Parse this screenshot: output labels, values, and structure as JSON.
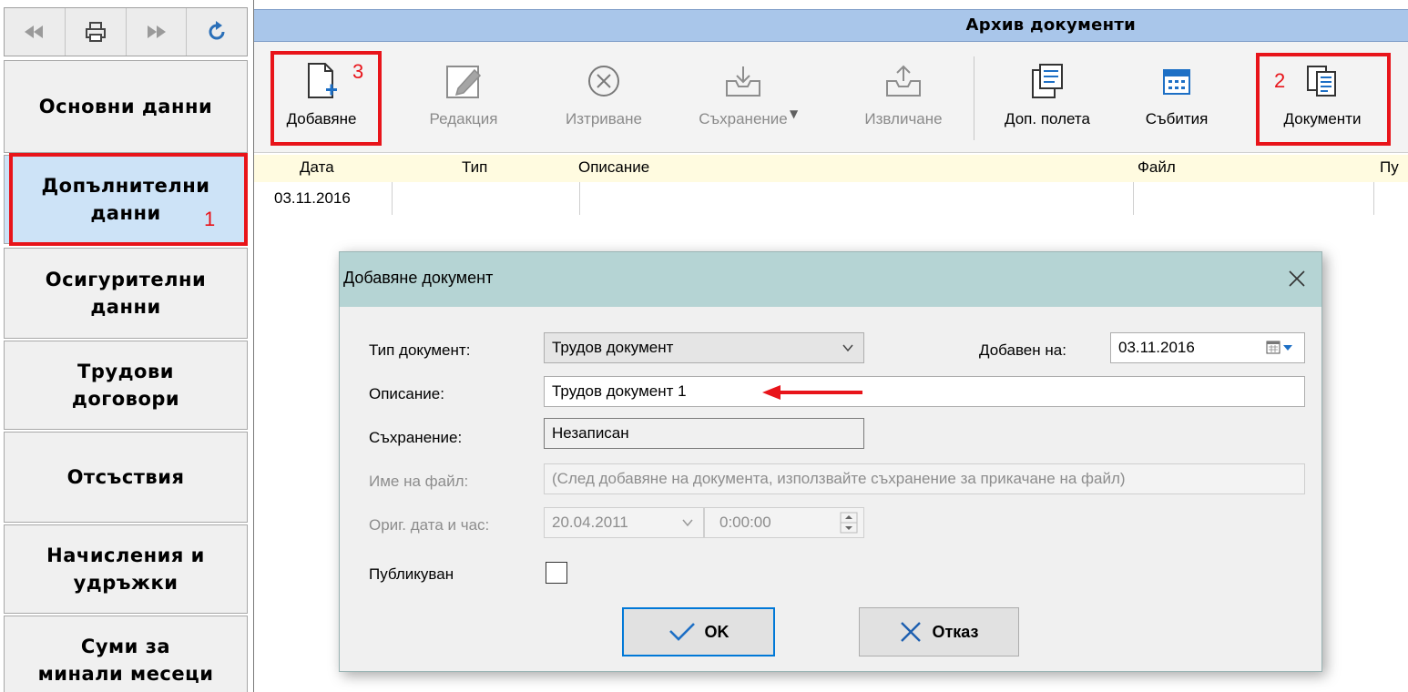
{
  "nav": {
    "items": [
      {
        "lines": [
          "Основни данни"
        ]
      },
      {
        "lines": [
          "Допълнителни",
          "данни"
        ]
      },
      {
        "lines": [
          "Осигурителни",
          "данни"
        ]
      },
      {
        "lines": [
          "Трудови",
          "договори"
        ]
      },
      {
        "lines": [
          "Отсъствия"
        ]
      },
      {
        "lines": [
          "Начисления и",
          "удръжки"
        ]
      },
      {
        "lines": [
          "Суми за",
          "минали месеци"
        ]
      }
    ]
  },
  "header": {
    "title": "Архив документи"
  },
  "toolbar": {
    "add_label": "Добавяне",
    "edit_label": "Редакция",
    "delete_label": "Изтриване",
    "save_label": "Съхранение",
    "extract_label": "Извличане",
    "extra_fields_label": "Доп. полета",
    "events_label": "Събития",
    "documents_label": "Документи"
  },
  "annotations": {
    "one": "1",
    "two": "2",
    "three": "3"
  },
  "grid": {
    "columns": [
      "Дата",
      "Тип",
      "Описание",
      "Файл",
      "Пу"
    ],
    "rows": [
      {
        "date": "03.11.2016"
      }
    ]
  },
  "dialog": {
    "title": "Добавяне документ",
    "type_label": "Тип документ:",
    "type_value": "Трудов документ",
    "added_label": "Добавен на:",
    "added_value": "03.11.2016",
    "description_label": "Описание:",
    "description_value": "Трудов документ 1",
    "storage_label": "Съхранение:",
    "storage_value": "Незаписан",
    "filename_label": "Име на файл:",
    "filename_placeholder": "(След добавяне на документа, използвайте съхранение за прикачане на файл)",
    "orig_label": "Ориг. дата и час:",
    "orig_date": "20.04.2011",
    "orig_time": "0:00:00",
    "published_label": "Публикуван",
    "ok_label": "OK",
    "cancel_label": "Отказ"
  },
  "colors": {
    "annotation": "#e8141a",
    "title_bar": "#a9c6ea",
    "dialog_title": "#b5d4d4",
    "accent": "#0078d7",
    "active_nav": "#cde3f7"
  }
}
